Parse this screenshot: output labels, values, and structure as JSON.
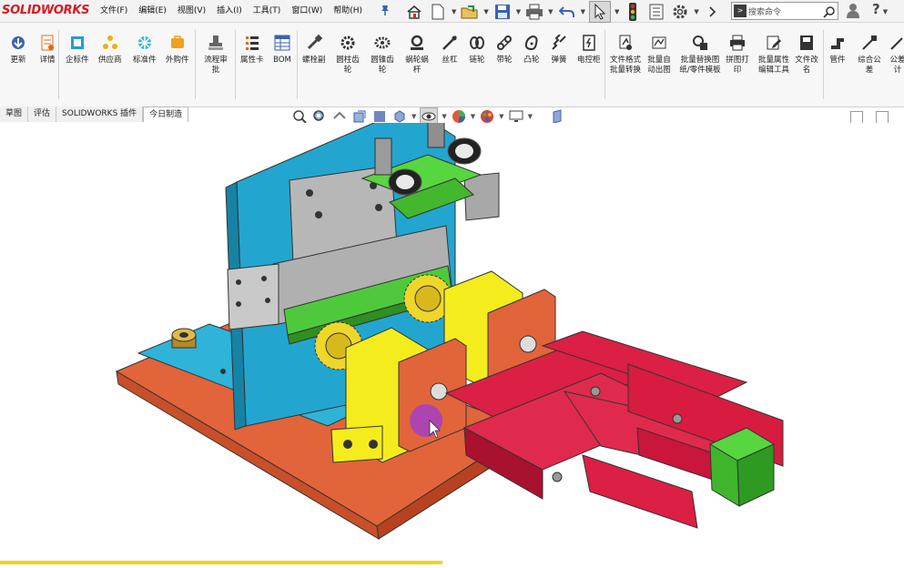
{
  "app": {
    "logo_prefix": "S",
    "logo_text": "OLIDWORKS",
    "menus": [
      "文件(F)",
      "编辑(E)",
      "视图(V)",
      "插入(I)",
      "工具(T)",
      "窗口(W)",
      "帮助(H)"
    ]
  },
  "search": {
    "placeholder": "搜索命令"
  },
  "toolbar": {
    "tools": [
      {
        "id": "update",
        "label": "更新"
      },
      {
        "id": "details",
        "label": "详情"
      },
      {
        "id": "enterprise-parts",
        "label": "企标件"
      },
      {
        "id": "suppliers",
        "label": "供应商"
      },
      {
        "id": "standard-parts",
        "label": "标准件"
      },
      {
        "id": "purchased-parts",
        "label": "外购件"
      },
      {
        "id": "process-approval",
        "label": "流程审批"
      },
      {
        "id": "properties",
        "label": "属性卡"
      },
      {
        "id": "bom",
        "label": "BOM"
      },
      {
        "id": "screw-pair",
        "label": "螺栓副"
      },
      {
        "id": "spur-gear",
        "label": "圆柱齿轮"
      },
      {
        "id": "bevel-gear",
        "label": "圆锥齿轮"
      },
      {
        "id": "worm-gear",
        "label": "蜗轮蜗杆"
      },
      {
        "id": "lead-screw",
        "label": "丝杠"
      },
      {
        "id": "sprocket",
        "label": "链轮"
      },
      {
        "id": "belt-wheel",
        "label": "带轮"
      },
      {
        "id": "cam",
        "label": "凸轮"
      },
      {
        "id": "spring",
        "label": "弹簧"
      },
      {
        "id": "control-box",
        "label": "电控柜"
      },
      {
        "id": "batch-format",
        "label": "文件格式批量转换"
      },
      {
        "id": "auto-drawing",
        "label": "批量自动出图"
      },
      {
        "id": "batch-replace",
        "label": "批量替换图纸/零件模板"
      },
      {
        "id": "print",
        "label": "拼图打印"
      },
      {
        "id": "batch-props",
        "label": "批量属性编辑工具"
      },
      {
        "id": "rename",
        "label": "文件改名"
      },
      {
        "id": "pipes",
        "label": "管件"
      },
      {
        "id": "tolerance",
        "label": "综合公差"
      },
      {
        "id": "misc",
        "label": "公差计"
      }
    ]
  },
  "tabs": [
    "草图",
    "评估",
    "SOLIDWORKS 插件",
    "今日制造"
  ],
  "colors": {
    "base_plate": "#e2643a",
    "back_plate": "#22a6cf",
    "rack_green": "#4fc93c",
    "gray_parts": "#b7b7b7",
    "yellow_blocks": "#f4ec1c",
    "gear_yellow": "#efd62a",
    "red_grippers": "#dc1f44",
    "cursor_purple": "#9b3bd8",
    "status_yellow": "#f6d11a"
  }
}
